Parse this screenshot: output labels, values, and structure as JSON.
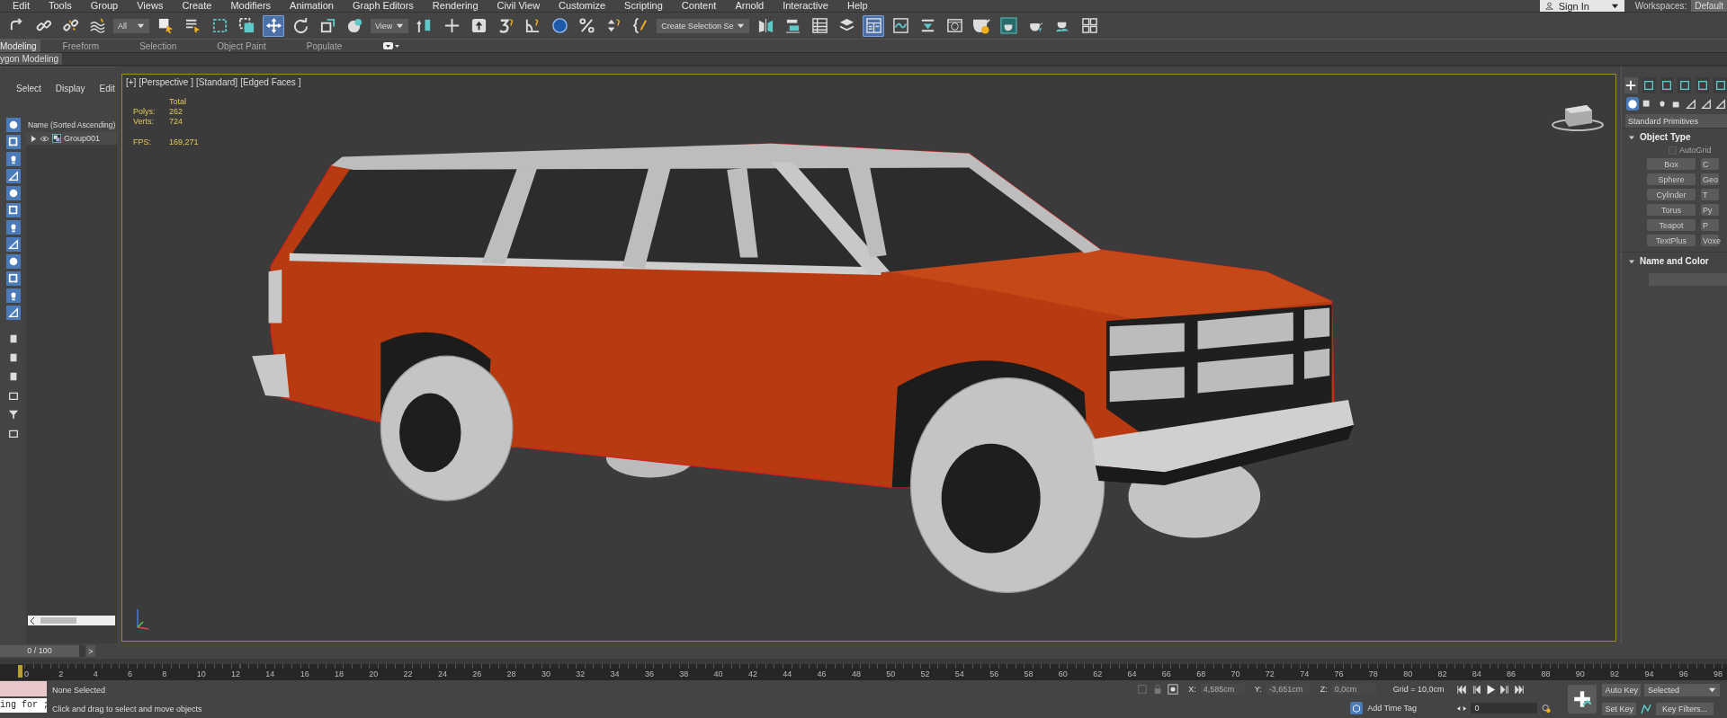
{
  "menu": [
    "Edit",
    "Tools",
    "Group",
    "Views",
    "Create",
    "Modifiers",
    "Animation",
    "Graph Editors",
    "Rendering",
    "Civil View",
    "Customize",
    "Scripting",
    "Content",
    "Arnold",
    "Interactive",
    "Help"
  ],
  "account": {
    "sign_in": "Sign In",
    "workspaces_label": "Workspaces:",
    "workspace": "Default"
  },
  "toolbar": [
    {
      "kind": "tool",
      "selected": false
    },
    {
      "kind": "tool",
      "selected": false
    },
    {
      "kind": "tool",
      "selected": false
    },
    {
      "kind": "tool",
      "selected": false
    },
    {
      "kind": "dropdown",
      "value": "All"
    },
    {
      "kind": "tool",
      "selected": false
    },
    {
      "kind": "tool",
      "selected": false
    },
    {
      "kind": "tool",
      "selected": false
    },
    {
      "kind": "tool",
      "selected": false
    },
    {
      "kind": "tool",
      "selected": true
    },
    {
      "kind": "tool",
      "selected": false
    },
    {
      "kind": "tool",
      "selected": false
    },
    {
      "kind": "tool",
      "selected": false
    },
    {
      "kind": "dropdown",
      "value": "View"
    },
    {
      "kind": "tool",
      "selected": false
    },
    {
      "kind": "tool",
      "selected": false
    },
    {
      "kind": "tool",
      "selected": false
    },
    {
      "kind": "tool",
      "selected": false
    },
    {
      "kind": "tool",
      "selected": false
    },
    {
      "kind": "tool",
      "selected": false
    },
    {
      "kind": "tool",
      "selected": false
    },
    {
      "kind": "tool",
      "selected": false
    },
    {
      "kind": "tool",
      "selected": false
    },
    {
      "kind": "dropdown",
      "value": "Create Selection Se"
    },
    {
      "kind": "tool",
      "selected": false
    },
    {
      "kind": "tool",
      "selected": false
    },
    {
      "kind": "tool",
      "selected": false
    },
    {
      "kind": "tool",
      "selected": false
    },
    {
      "kind": "tool",
      "selected": true
    },
    {
      "kind": "tool",
      "selected": false
    },
    {
      "kind": "tool",
      "selected": false
    },
    {
      "kind": "tool",
      "selected": false
    },
    {
      "kind": "tool",
      "selected": false
    },
    {
      "kind": "tool",
      "selected": false
    },
    {
      "kind": "tool",
      "selected": false
    },
    {
      "kind": "tool",
      "selected": false
    },
    {
      "kind": "tool",
      "selected": false
    }
  ],
  "ribbon": {
    "tabs": [
      {
        "label": "Modeling",
        "selected": true
      },
      {
        "label": "Freeform",
        "selected": false
      },
      {
        "label": "Selection",
        "selected": false
      },
      {
        "label": "Object Paint",
        "selected": false
      },
      {
        "label": "Populate",
        "selected": false
      }
    ],
    "panel": "ygon Modeling"
  },
  "explorer": {
    "tabs": [
      "Select",
      "Display",
      "Edit"
    ],
    "filters": [
      {
        "on": true
      },
      {
        "on": true
      },
      {
        "on": true
      },
      {
        "on": true
      },
      {
        "on": true
      },
      {
        "on": true
      },
      {
        "on": true
      },
      {
        "on": true
      },
      {
        "on": true
      },
      {
        "on": true
      },
      {
        "on": true
      },
      {
        "on": true
      }
    ],
    "column": "Name (Sorted Ascending)",
    "items": [
      {
        "name": "Group001",
        "expanded": false
      }
    ]
  },
  "viewport": {
    "labels": [
      "[+]",
      "[Perspective ]",
      "[Standard]",
      "[Edged Faces ]"
    ],
    "stats": {
      "header": "Total",
      "rows": [
        {
          "label": "Polys:",
          "value": "262"
        },
        {
          "label": "Verts:",
          "value": "724"
        }
      ],
      "fps_label": "FPS:",
      "fps": "169,271"
    }
  },
  "command_panel": {
    "tabs": [
      {
        "selected": true
      },
      {
        "selected": false
      },
      {
        "selected": false
      },
      {
        "selected": false
      },
      {
        "selected": false
      },
      {
        "selected": false
      }
    ],
    "categories": [
      {
        "selected": true
      },
      {
        "selected": false
      },
      {
        "selected": false
      },
      {
        "selected": false
      },
      {
        "selected": false
      },
      {
        "selected": false
      },
      {
        "selected": false
      }
    ],
    "dropdown": "Standard Primitives",
    "object_type": {
      "title": "Object Type",
      "expanded": true,
      "autogrid": {
        "label": "AutoGrid",
        "checked": false,
        "disabled": true
      },
      "buttons": [
        "Box",
        "C",
        "Sphere",
        "Geo",
        "Cylinder",
        "T",
        "Torus",
        "Py",
        "Teapot",
        "P",
        "TextPlus",
        "Voxe"
      ]
    },
    "name_color": {
      "title": "Name and Color",
      "expanded": true
    }
  },
  "time_slider": {
    "label": "0 / 100",
    "level": 0,
    "next": ">"
  },
  "ruler": [
    "0",
    "2",
    "4",
    "6",
    "8",
    "10",
    "12",
    "14",
    "16",
    "18",
    "20",
    "22",
    "24",
    "26",
    "28",
    "30",
    "32",
    "34",
    "36",
    "38",
    "40",
    "42",
    "44",
    "46",
    "48",
    "50",
    "52",
    "54",
    "56",
    "58",
    "60",
    "62",
    "64",
    "66",
    "68",
    "70",
    "72",
    "74",
    "76",
    "78",
    "80",
    "82",
    "84",
    "86",
    "88",
    "90",
    "92",
    "94",
    "96",
    "98"
  ],
  "status": {
    "listener": "ing for ;",
    "selection": "None Selected",
    "prompt": "Click and drag to select and move objects",
    "coords": [
      {
        "label": "X:",
        "value": "4,585cm",
        "disabled": true
      },
      {
        "label": "Y:",
        "value": "-3,651cm",
        "disabled": true
      },
      {
        "label": "Z:",
        "value": "0,0cm",
        "disabled": true
      }
    ],
    "grid": "Grid = 10,0cm",
    "time_tag": "Add Time Tag",
    "frame": "0",
    "auto_key": "Auto Key",
    "set_key": "Set Key",
    "key_mode": "Selected",
    "key_filters": "Key Filters..."
  }
}
